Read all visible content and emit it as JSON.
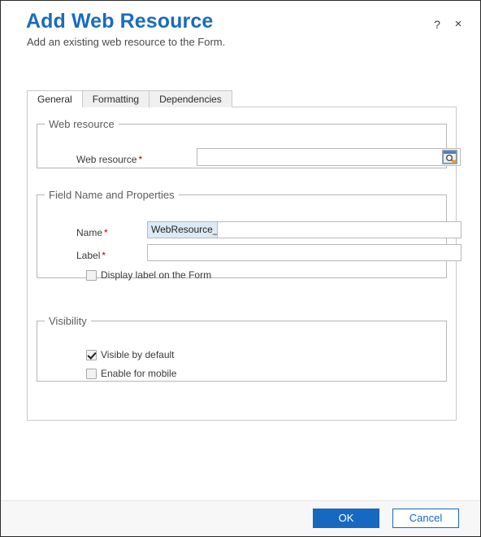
{
  "header": {
    "title": "Add Web Resource",
    "subtitle": "Add an existing web resource to the Form.",
    "help_icon": "?",
    "close_icon": "×",
    "title_color": "#1a6cbd"
  },
  "tabs": [
    {
      "label": "General",
      "active": true
    },
    {
      "label": "Formatting",
      "active": false
    },
    {
      "label": "Dependencies",
      "active": false
    }
  ],
  "groups": {
    "web_resource": {
      "legend": "Web resource",
      "field_label": "Web resource",
      "required_marker": "*",
      "value": "",
      "placeholder": "",
      "lookup_icon": "lookup-browse-icon"
    },
    "field_name_properties": {
      "legend": "Field Name and Properties",
      "name_label": "Name",
      "name_required_marker": "*",
      "name_prefix": "WebResource_",
      "name_value": "",
      "label_label": "Label",
      "label_required_marker": "*",
      "label_value": "",
      "display_label_checkbox": "Display label on the Form",
      "display_label_checked": false
    },
    "visibility": {
      "legend": "Visibility",
      "visible_by_default": "Visible by default",
      "visible_by_default_checked": true,
      "enable_for_mobile": "Enable for mobile",
      "enable_for_mobile_checked": false
    }
  },
  "footer": {
    "ok_label": "OK",
    "cancel_label": "Cancel",
    "primary_color": "#1668c1"
  }
}
